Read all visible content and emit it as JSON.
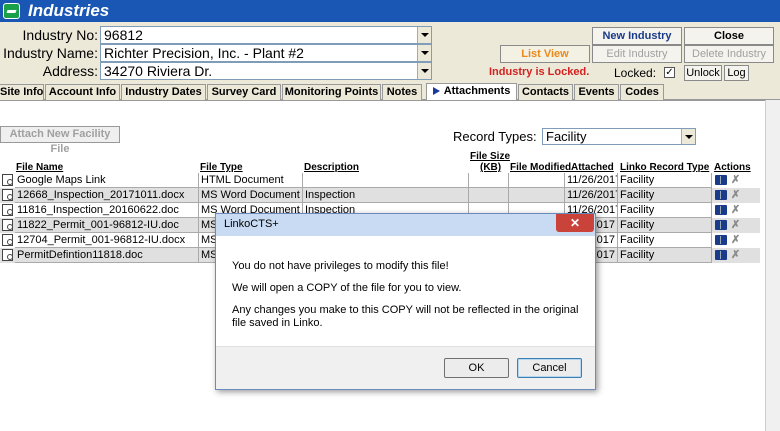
{
  "window": {
    "title": "Industries"
  },
  "header": {
    "industry_no_label": "Industry No:",
    "industry_no_value": "96812",
    "industry_name_label": "Industry Name:",
    "industry_name_value": "Richter Precision, Inc. - Plant #2",
    "address_label": "Address:",
    "address_value": "34270 Riviera Dr.",
    "list_view_label": "List View",
    "new_industry_label": "New Industry",
    "close_label": "Close",
    "edit_industry_label": "Edit Industry",
    "delete_industry_label": "Delete Industry",
    "locked_message": "Industry is Locked.",
    "locked_label": "Locked:",
    "locked_checked": "✓",
    "unlock_label": "Unlock",
    "log_label": "Log"
  },
  "tabs": [
    {
      "label": "Site Info"
    },
    {
      "label": "Account Info"
    },
    {
      "label": "Industry Dates"
    },
    {
      "label": "Survey Card"
    },
    {
      "label": "Monitoring Points"
    },
    {
      "label": "Notes"
    },
    {
      "label": "Attachments"
    },
    {
      "label": "Contacts"
    },
    {
      "label": "Events"
    },
    {
      "label": "Codes"
    }
  ],
  "attachments": {
    "attach_button_label": "Attach New Facility File",
    "record_types_label": "Record Types:",
    "record_types_value": "Facility",
    "columns": {
      "file_name": "File Name",
      "file_type": "File Type",
      "description": "Description",
      "file_size_line1": "File Size",
      "file_size_line2": "(KB)",
      "file_modified": "File Modified",
      "attached": "Attached",
      "linko_record_type": "Linko Record Type",
      "actions": "Actions"
    },
    "rows": [
      {
        "file_name": "Google Maps Link",
        "file_type": "HTML Document",
        "description": "",
        "attached": "11/26/2017",
        "record_type": "Facility"
      },
      {
        "file_name": "12668_Inspection_20171011.docx",
        "file_type": "MS Word Document",
        "description": "Inspection",
        "attached": "11/26/2017",
        "record_type": "Facility"
      },
      {
        "file_name": "11816_Inspection_20160622.doc",
        "file_type": "MS Word Document",
        "description": "Inspection",
        "attached": "11/26/2017",
        "record_type": "Facility"
      },
      {
        "file_name": "11822_Permit_001-96812-IU.doc",
        "file_type": "MS",
        "description": "",
        "attached": "2017",
        "record_type": "Facility"
      },
      {
        "file_name": "12704_Permit_001-96812-IU.docx",
        "file_type": "MS",
        "description": "",
        "attached": "2017",
        "record_type": "Facility"
      },
      {
        "file_name": "PermitDefintion11818.doc",
        "file_type": "MS",
        "description": "",
        "attached": "2017",
        "record_type": "Facility"
      }
    ]
  },
  "dialog": {
    "title": "LinkoCTS+",
    "close_glyph": "✕",
    "line1": "You do not have privileges to modify this file!",
    "line2": "We will open a COPY of the file for you to view.",
    "line3": "Any changes you make to this COPY will not be reflected in the original file saved in Linko.",
    "ok_label": "OK",
    "cancel_label": "Cancel"
  }
}
